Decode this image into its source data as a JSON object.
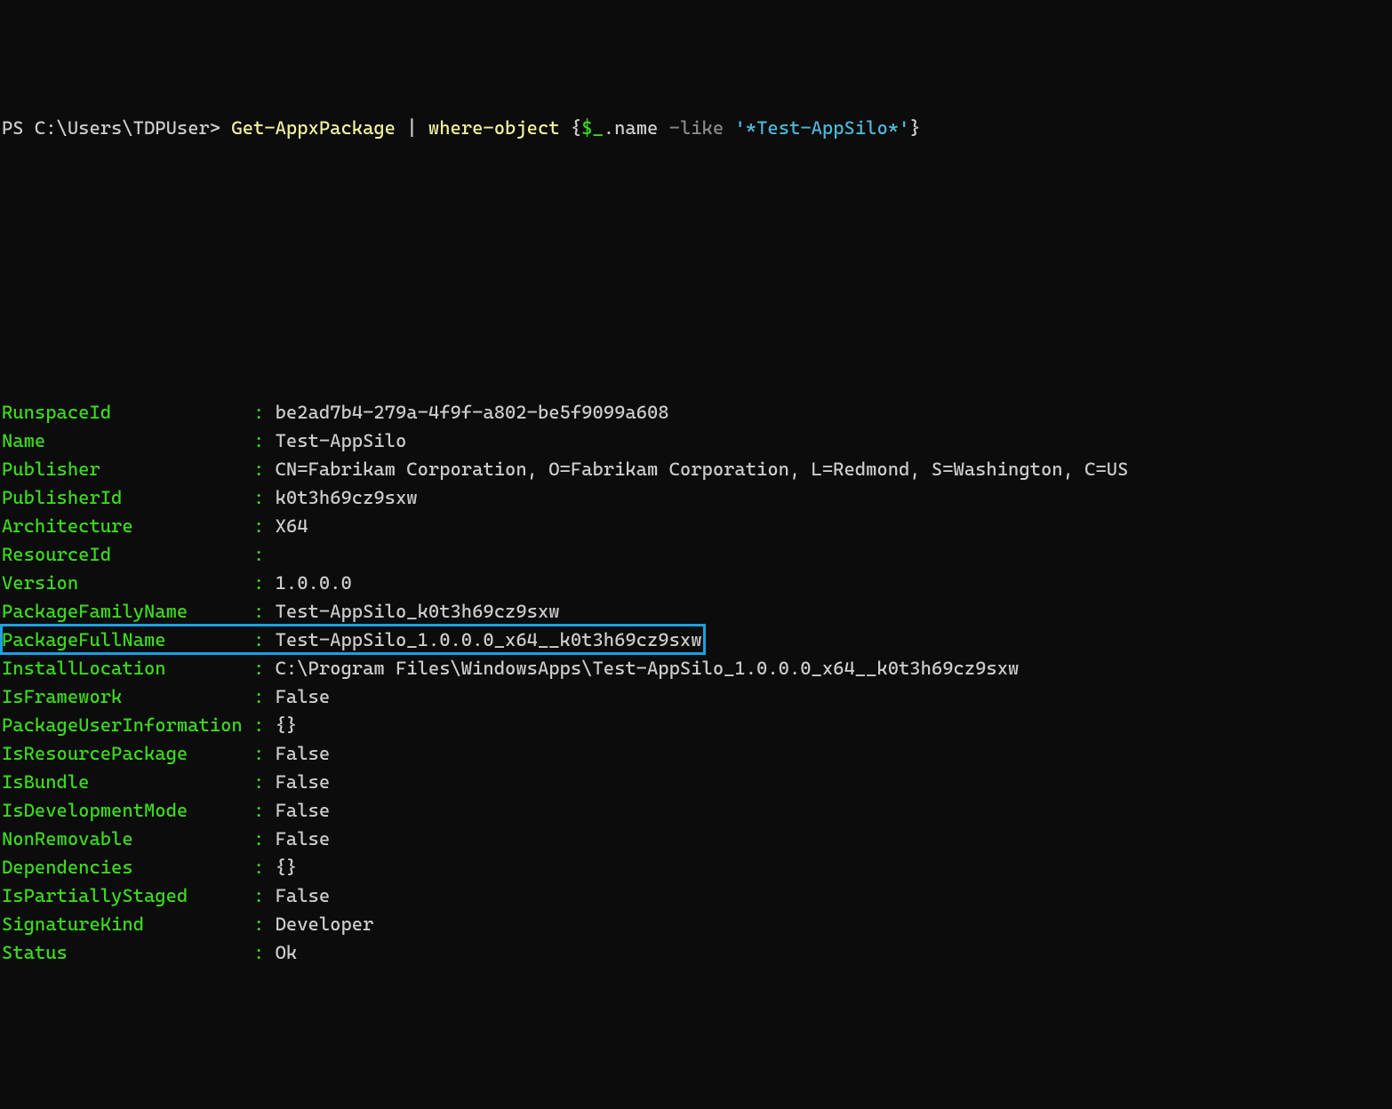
{
  "prompt": {
    "ps": "PS ",
    "path": "C:\\Users\\TDPUser",
    "gt": "> "
  },
  "command": {
    "cmdlet1": "Get-AppxPackage",
    "pipe": " | ",
    "cmdlet2": "where-object",
    "space1": " ",
    "brace_open": "{",
    "dollar_": "$_",
    "dot_name": ".name",
    "space2": " ",
    "like": "-like",
    "space3": " ",
    "string": "'*Test-AppSilo*'",
    "brace_close": "}"
  },
  "properties": [
    {
      "key": "RunspaceId",
      "value": "be2ad7b4-279a-4f9f-a802-be5f9099a608"
    },
    {
      "key": "Name",
      "value": "Test-AppSilo"
    },
    {
      "key": "Publisher",
      "value": "CN=Fabrikam Corporation, O=Fabrikam Corporation, L=Redmond, S=Washington, C=US"
    },
    {
      "key": "PublisherId",
      "value": "k0t3h69cz9sxw"
    },
    {
      "key": "Architecture",
      "value": "X64"
    },
    {
      "key": "ResourceId",
      "value": ""
    },
    {
      "key": "Version",
      "value": "1.0.0.0"
    },
    {
      "key": "PackageFamilyName",
      "value": "Test-AppSilo_k0t3h69cz9sxw"
    },
    {
      "key": "PackageFullName",
      "value": "Test-AppSilo_1.0.0.0_x64__k0t3h69cz9sxw",
      "highlighted": true
    },
    {
      "key": "InstallLocation",
      "value": "C:\\Program Files\\WindowsApps\\Test-AppSilo_1.0.0.0_x64__k0t3h69cz9sxw"
    },
    {
      "key": "IsFramework",
      "value": "False"
    },
    {
      "key": "PackageUserInformation",
      "value": "{}"
    },
    {
      "key": "IsResourcePackage",
      "value": "False"
    },
    {
      "key": "IsBundle",
      "value": "False"
    },
    {
      "key": "IsDevelopmentMode",
      "value": "False"
    },
    {
      "key": "NonRemovable",
      "value": "False"
    },
    {
      "key": "Dependencies",
      "value": "{}"
    },
    {
      "key": "IsPartiallyStaged",
      "value": "False"
    },
    {
      "key": "SignatureKind",
      "value": "Developer"
    },
    {
      "key": "Status",
      "value": "Ok"
    }
  ],
  "layout": {
    "key_width": 22,
    "sep": " : "
  }
}
